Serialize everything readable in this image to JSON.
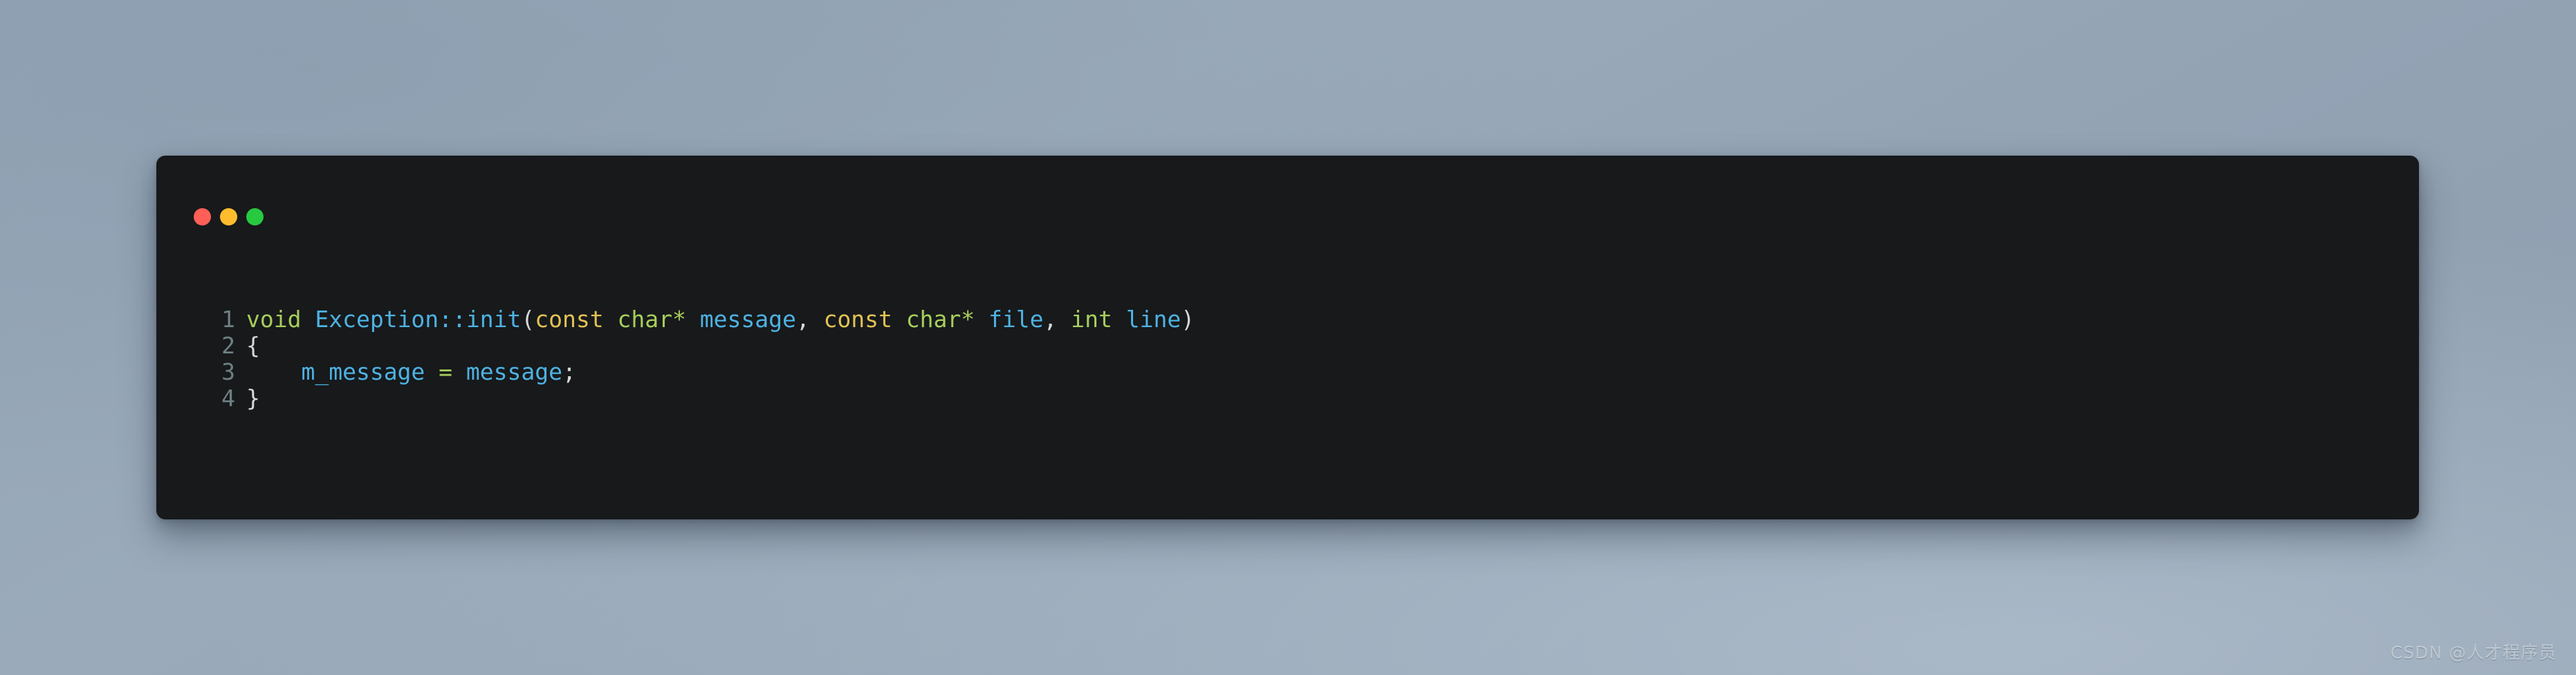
{
  "background": {
    "base_color": "#9aaaba",
    "accent_light": "#becdda"
  },
  "code_window": {
    "background_color": "#17191b",
    "corner_radius_px": 13,
    "titlebar": {
      "buttons": [
        {
          "name": "close",
          "icon": "close-traffic-light",
          "color": "#ff5f56"
        },
        {
          "name": "minimize",
          "icon": "minimize-traffic-light",
          "color": "#ffbd2e"
        },
        {
          "name": "maximize",
          "icon": "maximize-traffic-light",
          "color": "#27c93f"
        }
      ]
    },
    "language": "cpp",
    "gutter_color": "#6e8083",
    "syntax_colors": {
      "keyword": "#a7ce5b",
      "identifier": "#4eb2e2",
      "storage": "#e2c255",
      "punctuation": "#d7d9d8"
    },
    "lines": [
      {
        "number": "1",
        "text": "void Exception::init(const char* message, const char* file, int line)",
        "tokens": [
          {
            "t": "void",
            "c": "kw"
          },
          {
            "t": " ",
            "c": "pun"
          },
          {
            "t": "Exception",
            "c": "id"
          },
          {
            "t": "::",
            "c": "id"
          },
          {
            "t": "init",
            "c": "id"
          },
          {
            "t": "(",
            "c": "pun"
          },
          {
            "t": "const",
            "c": "sto"
          },
          {
            "t": " ",
            "c": "pun"
          },
          {
            "t": "char",
            "c": "kw"
          },
          {
            "t": "*",
            "c": "kw"
          },
          {
            "t": " ",
            "c": "pun"
          },
          {
            "t": "message",
            "c": "id"
          },
          {
            "t": ",",
            "c": "pun"
          },
          {
            "t": " ",
            "c": "pun"
          },
          {
            "t": "const",
            "c": "sto"
          },
          {
            "t": " ",
            "c": "pun"
          },
          {
            "t": "char",
            "c": "kw"
          },
          {
            "t": "*",
            "c": "kw"
          },
          {
            "t": " ",
            "c": "pun"
          },
          {
            "t": "file",
            "c": "id"
          },
          {
            "t": ",",
            "c": "pun"
          },
          {
            "t": " ",
            "c": "pun"
          },
          {
            "t": "int",
            "c": "kw"
          },
          {
            "t": " ",
            "c": "pun"
          },
          {
            "t": "line",
            "c": "id"
          },
          {
            "t": ")",
            "c": "pun"
          }
        ]
      },
      {
        "number": "2",
        "text": "{",
        "tokens": [
          {
            "t": "{",
            "c": "pun"
          }
        ]
      },
      {
        "number": "3",
        "text": "    m_message = message;",
        "tokens": [
          {
            "t": "    ",
            "c": "pun"
          },
          {
            "t": "m_message",
            "c": "id"
          },
          {
            "t": " ",
            "c": "pun"
          },
          {
            "t": "=",
            "c": "kw"
          },
          {
            "t": " ",
            "c": "pun"
          },
          {
            "t": "message",
            "c": "id"
          },
          {
            "t": ";",
            "c": "pun"
          }
        ]
      },
      {
        "number": "4",
        "text": "}",
        "tokens": [
          {
            "t": "}",
            "c": "pun"
          }
        ]
      }
    ]
  },
  "watermark": {
    "text": "CSDN @人才程序员"
  }
}
